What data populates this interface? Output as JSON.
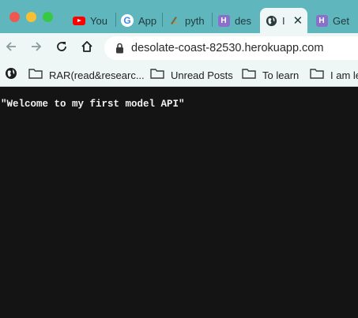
{
  "colors": {
    "tabstrip": "#5fb7bd",
    "toolbar": "#eef6f6",
    "page_background": "#141414",
    "page_text": "#f2f2f2"
  },
  "tabs": [
    {
      "title": "You",
      "icon": "youtube-icon",
      "active": false
    },
    {
      "title": "App",
      "icon": "google-icon",
      "active": false
    },
    {
      "title": "pyth",
      "icon": "python-icon",
      "active": false
    },
    {
      "title": "des",
      "icon": "heroku-icon",
      "active": false
    },
    {
      "title": "I",
      "icon": "globe-icon",
      "active": true
    },
    {
      "title": "Get",
      "icon": "heroku-icon",
      "active": false
    }
  ],
  "toolbar": {
    "url": "desolate-coast-82530.herokuapp.com",
    "back_icon": "back-arrow-icon",
    "forward_icon": "forward-arrow-icon",
    "reload_icon": "reload-icon",
    "home_icon": "home-icon",
    "lock_icon": "lock-icon"
  },
  "bookmarks": [
    {
      "label": "RAR(read&researc...",
      "icon": "folder-icon"
    },
    {
      "label": "Unread Posts",
      "icon": "folder-icon"
    },
    {
      "label": "To learn",
      "icon": "folder-icon"
    },
    {
      "label": "I am le",
      "icon": "folder-icon"
    }
  ],
  "page": {
    "body_text": "\"Welcome to my first model API\""
  }
}
